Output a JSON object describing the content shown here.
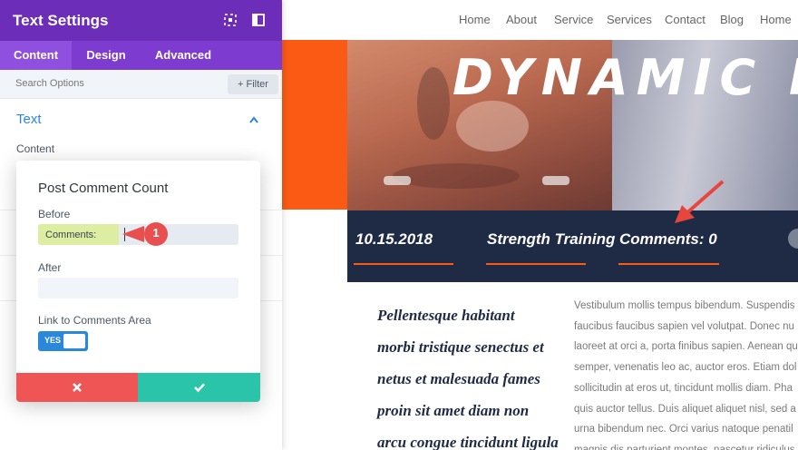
{
  "panel": {
    "title": "Text Settings",
    "tabs": [
      {
        "label": "Content",
        "active": true
      },
      {
        "label": "Design",
        "active": false
      },
      {
        "label": "Advanced",
        "active": false
      }
    ],
    "search_placeholder": "Search Options",
    "filter_label": "+ Filter",
    "section_title": "Text",
    "content_label": "Content"
  },
  "modal": {
    "title": "Post Comment Count",
    "before_label": "Before",
    "before_value": "Comments:",
    "after_label": "After",
    "after_value": "",
    "link_label": "Link to Comments Area",
    "toggle_label": "YES",
    "step_number": "1"
  },
  "site": {
    "nav": [
      "Home",
      "About",
      "Service",
      "Services",
      "Contact",
      "Blog",
      "Home"
    ],
    "hero_title": "DYNAMIC POS",
    "meta": {
      "date": "10.15.2018",
      "category": "Strength Training",
      "comments": "Comments: 0"
    },
    "quote_lines": [
      "Pellentesque habitant",
      "morbi tristique senectus et",
      "netus et malesuada fames",
      "proin sit amet diam non",
      "arcu congue tincidunt ligula"
    ],
    "body_lines": [
      "Vestibulum mollis tempus bibendum. Suspendis",
      "faucibus faucibus sapien vel volutpat. Donec nu",
      "laoreet at orci a, porta finibus sapien. Aenean qu",
      "semper, venenatis leo ac, auctor eros. Etiam dol",
      "sollicitudin at eros ut, tincidunt mollis diam. Pha",
      "quis auctor tellus. Duis aliquet aliquet nisl, sed a",
      "urna bibendum nec. Orci varius natoque penatil",
      "magnis dis parturient montes, nascetur ridiculus"
    ]
  },
  "colors": {
    "panel_header": "#6c2eb9",
    "tabs_bg": "#7d3bcf",
    "accent_blue": "#2b87da",
    "cancel_red": "#ef5555",
    "save_green": "#29c4a9",
    "orange": "#fa5a14",
    "navy": "#1f2a44"
  },
  "icons": [
    "expand-icon",
    "split-view-icon",
    "chevron-up-icon",
    "close-icon",
    "check-icon",
    "arrow-pointer-icon"
  ]
}
